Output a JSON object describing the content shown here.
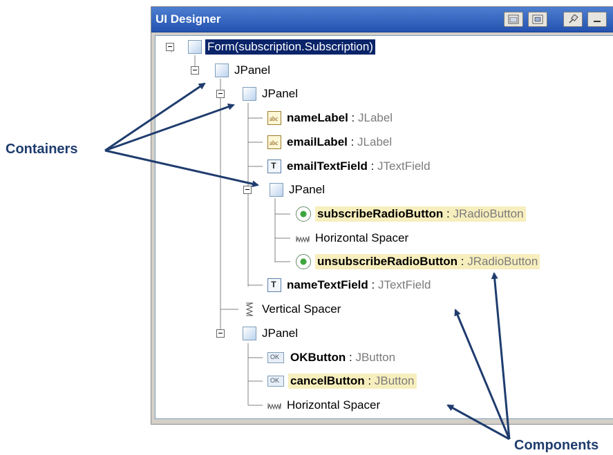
{
  "window": {
    "title": "UI Designer",
    "buttons": [
      {
        "name": "restore-window-button",
        "icon": "window-restore-icon"
      },
      {
        "name": "pin-window-button",
        "icon": "window-dock-icon"
      },
      {
        "name": "pin-button",
        "icon": "pin-icon"
      },
      {
        "name": "minimize-button",
        "icon": "minimize-icon"
      }
    ]
  },
  "tree": {
    "nodes": [
      {
        "name": "Form(subscription.Subscription)",
        "type": "",
        "icon": "form-icon",
        "selected": true
      },
      {
        "name": "JPanel",
        "type": "",
        "icon": "panel-icon"
      },
      {
        "name": "JPanel",
        "type": "",
        "icon": "panel-icon"
      },
      {
        "name": "nameLabel",
        "type": "JLabel",
        "icon": "label-icon"
      },
      {
        "name": "emailLabel",
        "type": "JLabel",
        "icon": "label-icon"
      },
      {
        "name": "emailTextField",
        "type": "JTextField",
        "icon": "textfield-icon"
      },
      {
        "name": "JPanel",
        "type": "",
        "icon": "panel-icon"
      },
      {
        "name": "subscribeRadioButton",
        "type": "JRadioButton",
        "icon": "radio-icon",
        "highlighted": true
      },
      {
        "name": "Horizontal Spacer",
        "type": "",
        "icon": "horizontal-spacer-icon"
      },
      {
        "name": "unsubscribeRadioButton",
        "type": "JRadioButton",
        "icon": "radio-icon",
        "highlighted": true
      },
      {
        "name": "nameTextField",
        "type": "JTextField",
        "icon": "textfield-icon"
      },
      {
        "name": "Vertical Spacer",
        "type": "",
        "icon": "vertical-spacer-icon"
      },
      {
        "name": "JPanel",
        "type": "",
        "icon": "panel-icon"
      },
      {
        "name": "OKButton",
        "type": "JButton",
        "icon": "button-icon"
      },
      {
        "name": "cancelButton",
        "type": "JButton",
        "icon": "button-icon",
        "highlighted": true
      },
      {
        "name": "Horizontal Spacer",
        "type": "",
        "icon": "horizontal-spacer-icon"
      }
    ],
    "separator": " : "
  },
  "callouts": {
    "containers": "Containers",
    "components": "Components"
  },
  "colors": {
    "callout": "#1f3c6e",
    "selection": "#0a246a",
    "highlight": "#f7eebd",
    "type_text": "#7b7b7b"
  }
}
